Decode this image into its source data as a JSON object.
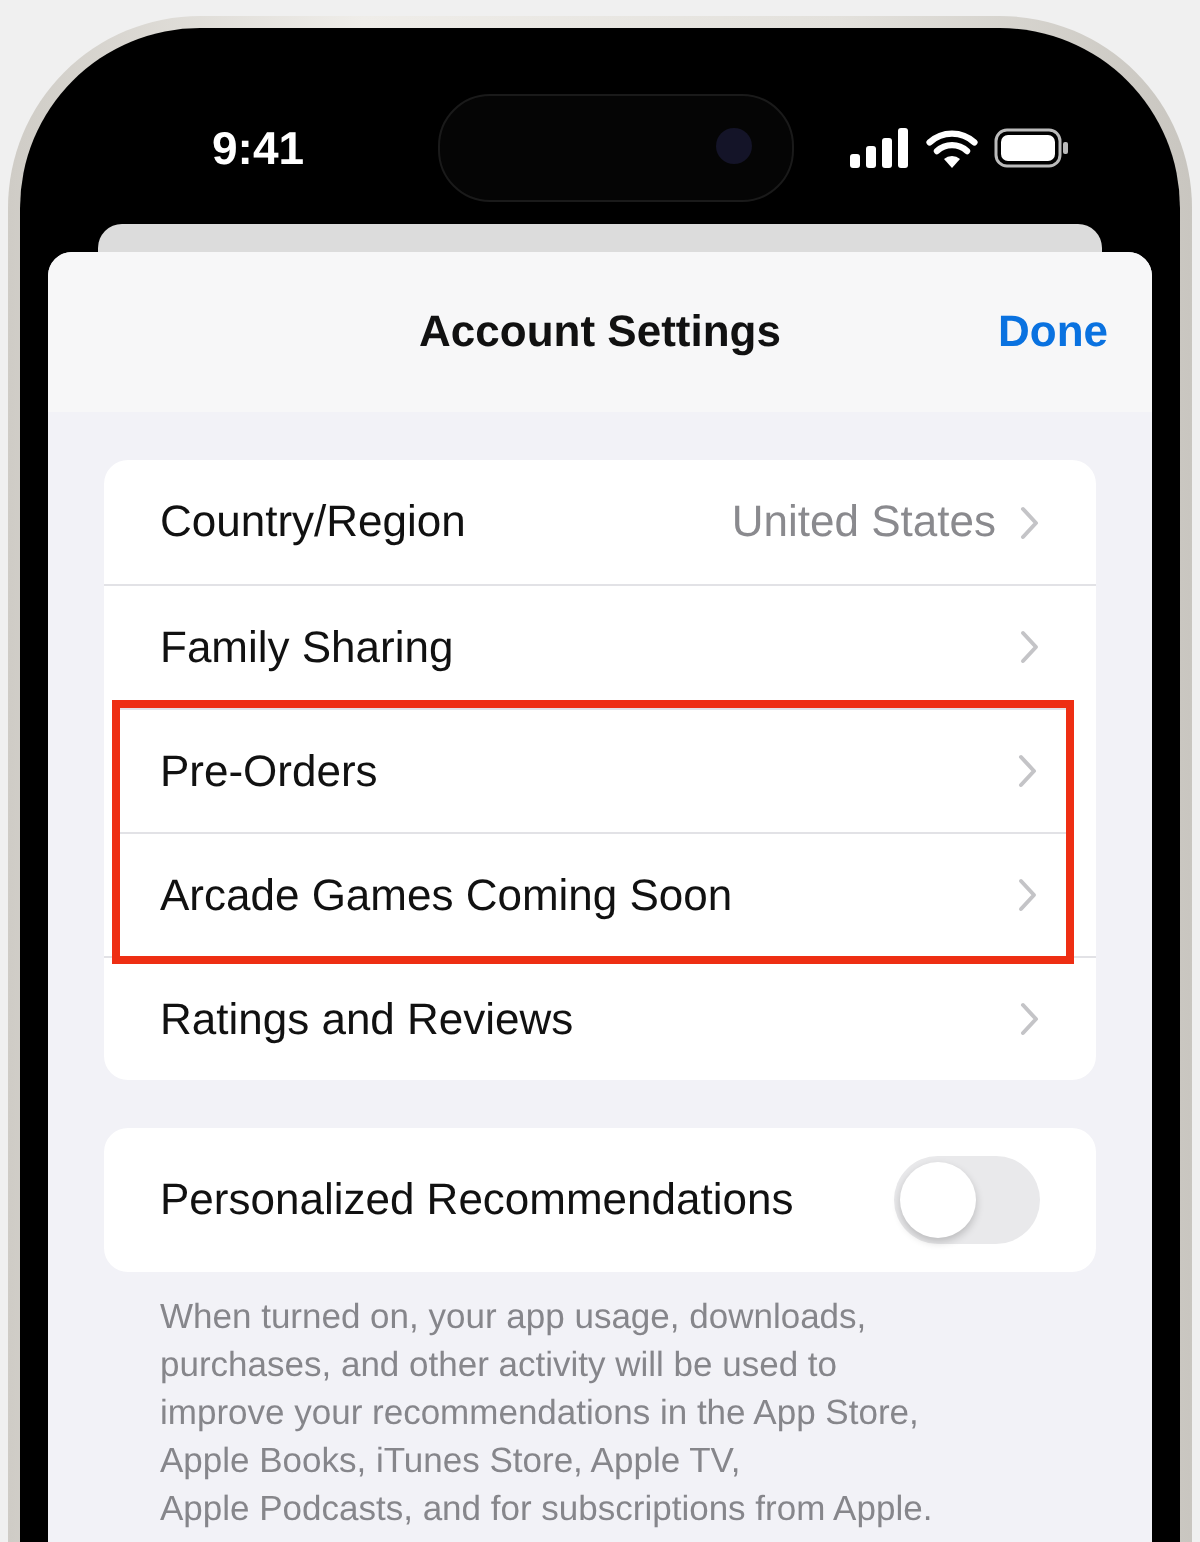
{
  "status_bar": {
    "time": "9:41"
  },
  "sheet": {
    "title": "Account Settings",
    "done": "Done"
  },
  "rows": [
    {
      "label": "Country/Region",
      "value": "United States",
      "highlighted": false
    },
    {
      "label": "Family Sharing",
      "highlighted": false
    },
    {
      "label": "Pre-Orders",
      "highlighted": true
    },
    {
      "label": "Arcade Games Coming Soon",
      "highlighted": true
    },
    {
      "label": "Ratings and Reviews",
      "highlighted": false
    }
  ],
  "recommendations": {
    "label": "Personalized Recommendations",
    "on": false
  },
  "footer_lines": [
    "When turned on, your app usage, downloads,",
    "purchases, and other activity will be used to",
    "improve your recommendations in the App Store,",
    "Apple Books, iTunes Store, Apple TV,",
    "Apple Podcasts, and for subscriptions from Apple."
  ]
}
